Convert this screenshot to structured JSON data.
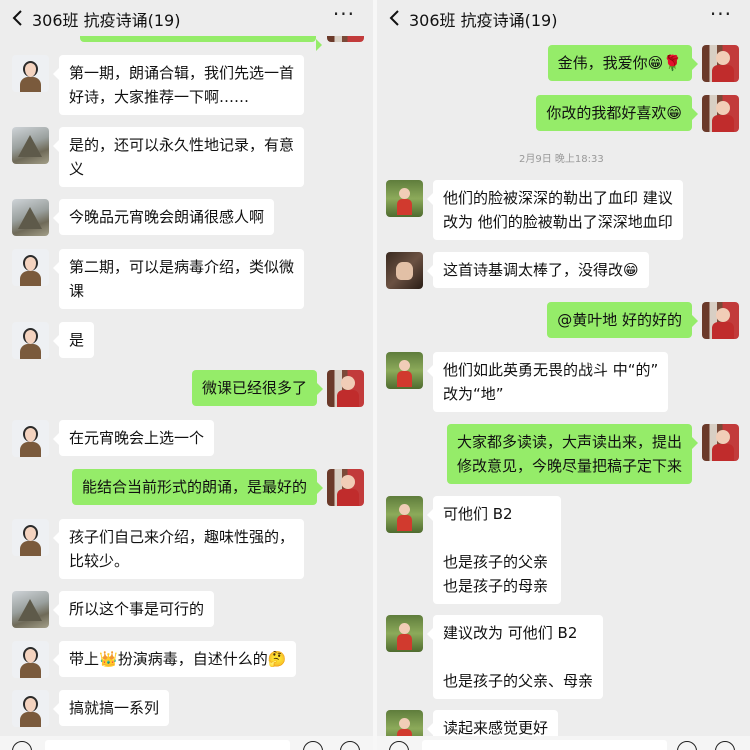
{
  "left": {
    "title": "306班  抗疫诗诵(19)",
    "more": "···",
    "messages": [
      {
        "lines": [
          "第一期，朗诵合辑，我们先选一首",
          "好诗，大家推荐一下啊……"
        ]
      },
      {
        "lines": [
          "是的，还可以永久性地记录，有意",
          "义"
        ]
      },
      {
        "lines": [
          "今晚品元宵晚会朗诵很感人啊"
        ]
      },
      {
        "lines": [
          "第二期，可以是病毒介绍，类似微",
          "课"
        ]
      },
      {
        "lines": [
          "是"
        ]
      },
      {
        "lines": [
          "微课已经很多了"
        ]
      },
      {
        "lines": [
          "在元宵晚会上选一个"
        ]
      },
      {
        "lines": [
          "能结合当前形式的朗诵，是最好的"
        ]
      },
      {
        "lines": [
          "孩子们自己来介绍，趣味性强的，",
          "比较少。"
        ]
      },
      {
        "lines": [
          "所以这个事是可行的"
        ]
      },
      {
        "lines": [
          "带上",
          "扮演病毒，自述什么的"
        ]
      },
      {
        "lines": [
          "搞就搞一系列"
        ]
      }
    ],
    "emoji_crown": "👑",
    "emoji_think": "🤔"
  },
  "right": {
    "title": "306班  抗疫诗诵(19)",
    "more": "···",
    "timestamp": "2月9日 晚上18:33",
    "messages": [
      {
        "lines": [
          "金伟，我爱你"
        ]
      },
      {
        "lines": [
          "你改的我都好喜欢"
        ]
      },
      {
        "lines": [
          "他们的脸被深深的勒出了血印 建议",
          "改为 他们的脸被勒出了深深地血印"
        ]
      },
      {
        "lines": [
          "这首诗基调太棒了，没得改"
        ]
      },
      {
        "lines": [
          "@黄叶地 好的好的"
        ]
      },
      {
        "lines": [
          "他们如此英勇无畏的战斗  中“的”",
          "改为“地”"
        ]
      },
      {
        "lines": [
          "大家都多读读，大声读出来，提出",
          "修改意见，今晚尽量把稿子定下来"
        ]
      },
      {
        "lines": [
          "可他们        B2",
          "",
          "也是孩子的父亲",
          "也是孩子的母亲"
        ]
      },
      {
        "lines": [
          "建议改为 可他们        B2",
          "",
          "也是孩子的父亲、母亲"
        ]
      },
      {
        "lines": [
          "读起来感觉更好"
        ]
      }
    ],
    "emoji_grin": "😁",
    "emoji_rose": "🌹"
  }
}
